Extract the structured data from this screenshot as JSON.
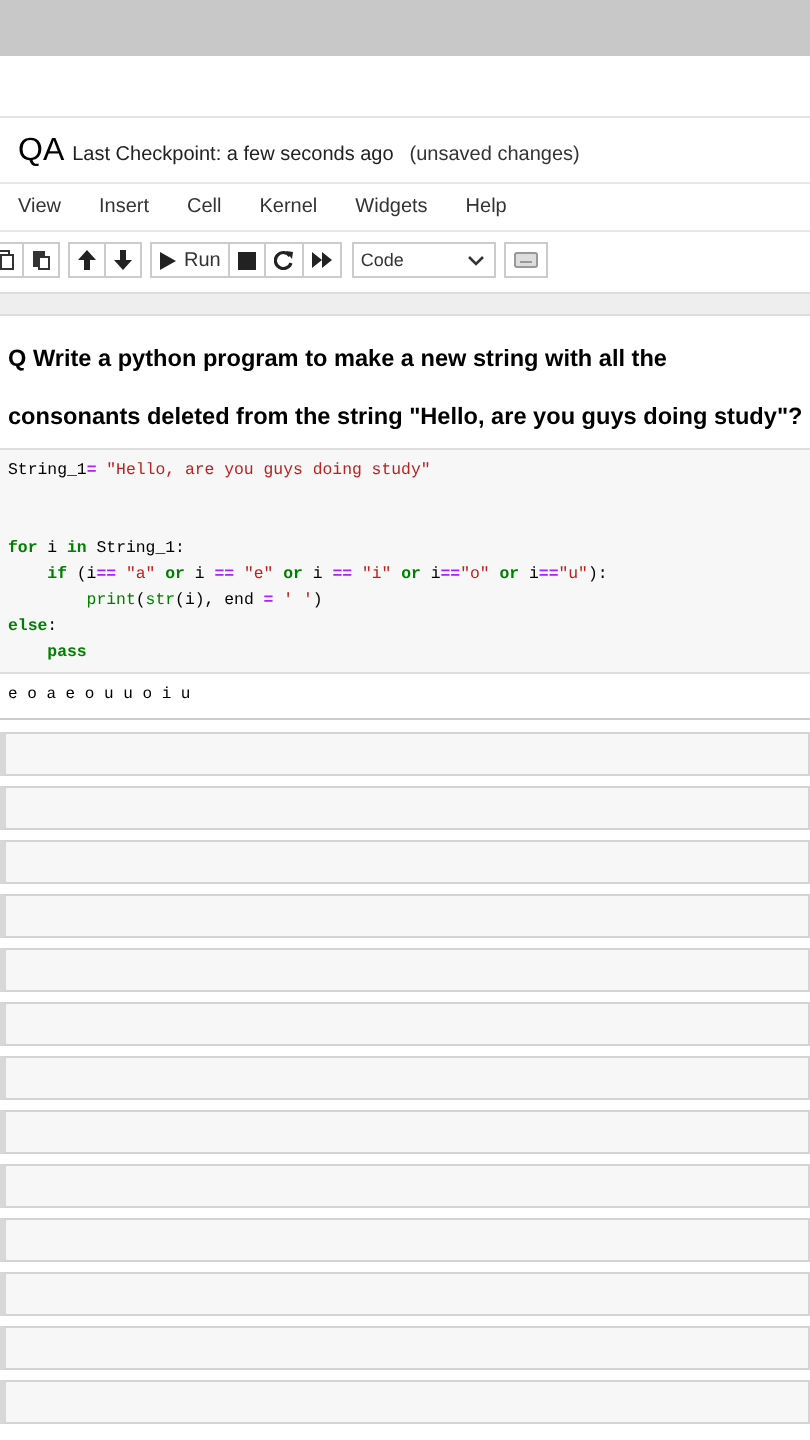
{
  "notebook": {
    "title": "QA",
    "checkpoint": "Last Checkpoint: a few seconds ago",
    "save_status": "(unsaved changes)"
  },
  "menu": [
    {
      "label": "View"
    },
    {
      "label": "Insert"
    },
    {
      "label": "Cell"
    },
    {
      "label": "Kernel"
    },
    {
      "label": "Widgets"
    },
    {
      "label": "Help"
    }
  ],
  "toolbar": {
    "run_label": "Run",
    "cell_type": "Code"
  },
  "question": [
    "Q Write a python program to make a new string with all the",
    "consonants deleted from the string \"Hello, are you guys doing study\"?"
  ],
  "code_cell": {
    "blocks": [
      {
        "lines": [
          [
            {
              "kind": "plain",
              "text": "String_1"
            },
            {
              "kind": "op",
              "text": "="
            },
            {
              "kind": "str",
              "text": " \"Hello, are you guys doing study\""
            }
          ]
        ]
      },
      {
        "lines": [
          [
            {
              "kind": "kw",
              "text": "for"
            },
            {
              "kind": "plain",
              "text": " i "
            },
            {
              "kind": "kw",
              "text": "in"
            },
            {
              "kind": "plain",
              "text": " String_1:"
            }
          ],
          [
            {
              "kind": "kw",
              "text": "    if"
            },
            {
              "kind": "plain",
              "text": " (i"
            },
            {
              "kind": "op",
              "text": "=="
            },
            {
              "kind": "str",
              "text": " \"a\" "
            },
            {
              "kind": "kw",
              "text": "or"
            },
            {
              "kind": "plain",
              "text": " i "
            },
            {
              "kind": "op",
              "text": "=="
            },
            {
              "kind": "str",
              "text": " \"e\" "
            },
            {
              "kind": "kw",
              "text": "or"
            },
            {
              "kind": "plain",
              "text": " i "
            },
            {
              "kind": "op",
              "text": "=="
            },
            {
              "kind": "str",
              "text": " \"i\" "
            },
            {
              "kind": "kw",
              "text": "or"
            },
            {
              "kind": "plain",
              "text": " i"
            },
            {
              "kind": "op",
              "text": "=="
            },
            {
              "kind": "str",
              "text": "\"o\" "
            },
            {
              "kind": "kw",
              "text": "or"
            },
            {
              "kind": "plain",
              "text": " i"
            },
            {
              "kind": "op",
              "text": "=="
            },
            {
              "kind": "str",
              "text": "\"u\""
            },
            {
              "kind": "plain",
              "text": "):"
            }
          ],
          [
            {
              "kind": "builtin",
              "text": "        print"
            },
            {
              "kind": "plain",
              "text": "("
            },
            {
              "kind": "builtin",
              "text": "str"
            },
            {
              "kind": "plain",
              "text": "(i), end "
            },
            {
              "kind": "op",
              "text": "="
            },
            {
              "kind": "str",
              "text": " ' '"
            },
            {
              "kind": "plain",
              "text": ")"
            }
          ],
          [
            {
              "kind": "kw",
              "text": "else"
            },
            {
              "kind": "plain",
              "text": ":"
            }
          ],
          [
            {
              "kind": "kw",
              "text": "    pass"
            }
          ]
        ]
      }
    ],
    "output": "e o a e o u u o i u"
  },
  "empty_cells": [
    {
      "kind": "code"
    },
    {
      "kind": "code"
    },
    {
      "kind": "code"
    },
    {
      "kind": "code"
    },
    {
      "kind": "code"
    },
    {
      "kind": "code"
    },
    {
      "kind": "code"
    },
    {
      "kind": "code"
    },
    {
      "kind": "code"
    },
    {
      "kind": "code"
    },
    {
      "kind": "code"
    },
    {
      "kind": "code"
    },
    {
      "kind": "code"
    }
  ]
}
